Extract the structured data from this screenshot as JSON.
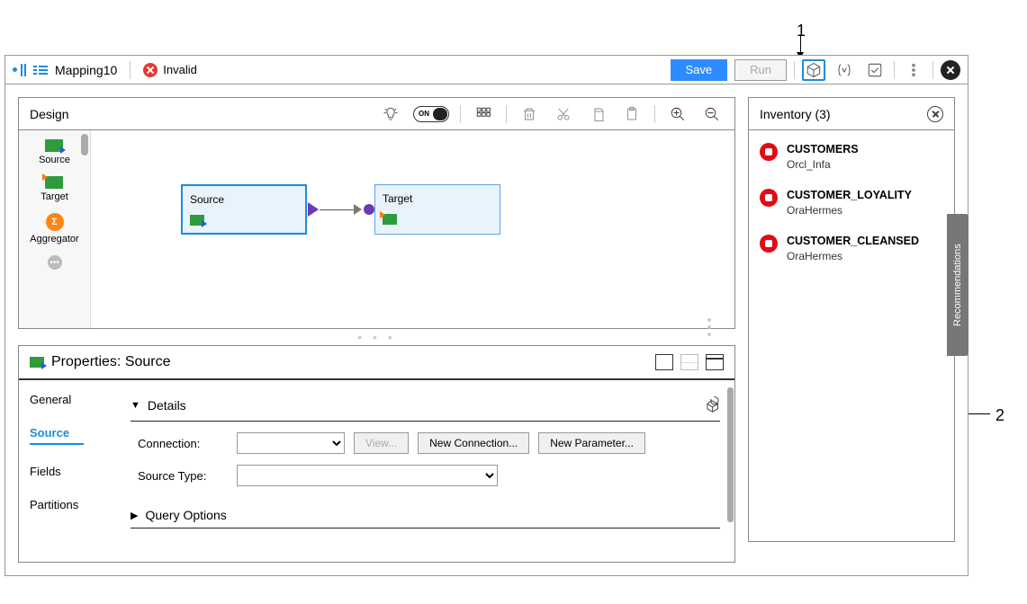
{
  "annotations": {
    "one": "1",
    "two": "2"
  },
  "titlebar": {
    "title": "Mapping10",
    "status": "Invalid",
    "save": "Save",
    "run": "Run"
  },
  "design": {
    "label": "Design",
    "toggle": "ON",
    "palette": {
      "source": "Source",
      "target": "Target",
      "aggregator": "Aggregator",
      "sigma": "Σ"
    },
    "nodes": {
      "source": "Source",
      "target": "Target"
    }
  },
  "properties": {
    "title": "Properties: Source",
    "tabs": {
      "general": "General",
      "source": "Source",
      "fields": "Fields",
      "partitions": "Partitions"
    },
    "details_label": "Details",
    "connection_label": "Connection:",
    "view_btn": "View...",
    "new_conn_btn": "New Connection...",
    "new_param_btn": "New Parameter...",
    "source_type_label": "Source Type:",
    "query_options_label": "Query Options"
  },
  "inventory": {
    "title": "Inventory (3)",
    "items": [
      {
        "name": "CUSTOMERS",
        "sub": "Orcl_Infa"
      },
      {
        "name": "CUSTOMER_LOYALITY",
        "sub": "OraHermes"
      },
      {
        "name": "CUSTOMER_CLEANSED",
        "sub": "OraHermes"
      }
    ]
  },
  "recommendations_tab": "Recommendations"
}
